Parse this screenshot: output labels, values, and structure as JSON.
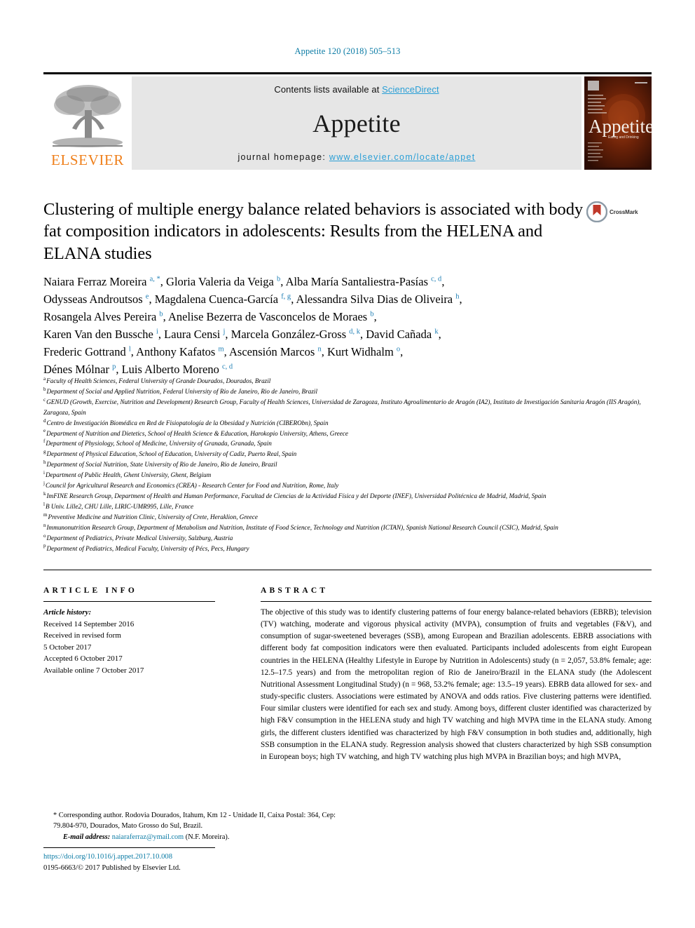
{
  "running_head": "Appetite 120 (2018) 505–513",
  "banner": {
    "publisher_name": "ELSEVIER",
    "contents_prefix": "Contents lists available at ",
    "contents_link": "ScienceDirect",
    "journal_name": "Appetite",
    "homepage_prefix": "journal homepage: ",
    "homepage_url": "www.elsevier.com/locate/appet",
    "cover_title": "Appetite",
    "cover_subtitle": "Eating and Drinking"
  },
  "article": {
    "title": "Clustering of multiple energy balance related behaviors is associated with body fat composition indicators in adolescents: Results from the HELENA and ELANA studies",
    "crossmark_label": "CrossMark"
  },
  "authors": {
    "lines": [
      [
        {
          "name": "Naiara Ferraz Moreira",
          "sup": "a, *"
        },
        {
          "name": "Gloria Valeria da Veiga",
          "sup": "b"
        },
        {
          "name": "Alba María Santaliestra-Pasías",
          "sup": "c, d"
        }
      ],
      [
        {
          "name": "Odysseas Androutsos",
          "sup": "e"
        },
        {
          "name": "Magdalena Cuenca-García",
          "sup": "f, g"
        },
        {
          "name": "Alessandra Silva Dias de Oliveira",
          "sup": "h"
        }
      ],
      [
        {
          "name": "Rosangela Alves Pereira",
          "sup": "b"
        },
        {
          "name": "Anelise Bezerra de Vasconcelos de Moraes",
          "sup": "b"
        }
      ],
      [
        {
          "name": "Karen Van den Bussche",
          "sup": "i"
        },
        {
          "name": "Laura Censi",
          "sup": "j"
        },
        {
          "name": "Marcela González-Gross",
          "sup": "d, k"
        },
        {
          "name": "David Cañada",
          "sup": "k"
        }
      ],
      [
        {
          "name": "Frederic Gottrand",
          "sup": "l"
        },
        {
          "name": "Anthony Kafatos",
          "sup": "m"
        },
        {
          "name": "Ascensión Marcos",
          "sup": "n"
        },
        {
          "name": "Kurt Widhalm",
          "sup": "o"
        }
      ],
      [
        {
          "name": "Dénes Mólnar",
          "sup": "p"
        },
        {
          "name": "Luis Alberto Moreno",
          "sup": "c, d"
        }
      ]
    ]
  },
  "affiliations": [
    {
      "mark": "a",
      "text": "Faculty of Health Sciences, Federal University of Grande Dourados, Dourados, Brazil"
    },
    {
      "mark": "b",
      "text": "Department of Social and Applied Nutrition, Federal University of Rio de Janeiro, Rio de Janeiro, Brazil"
    },
    {
      "mark": "c",
      "text": "GENUD (Growth, Exercise, Nutrition and Development) Research Group, Faculty of Health Sciences, Universidad de Zaragoza, Instituto Agroalimentario de Aragón (IA2), Instituto de Investigación Sanitaria Aragón (IIS Aragón), Zaragoza, Spain"
    },
    {
      "mark": "d",
      "text": "Centro de Investigación Biomédica en Red de Fisiopatología de la Obesidad y Nutrición (CIBERObn), Spain"
    },
    {
      "mark": "e",
      "text": "Department of Nutrition and Dietetics, School of Health Science & Education, Harokopio University, Athens, Greece"
    },
    {
      "mark": "f",
      "text": "Department of Physiology, School of Medicine, University of Granada, Granada, Spain"
    },
    {
      "mark": "g",
      "text": "Department of Physical Education, School of Education, University of Cadiz, Puerto Real, Spain"
    },
    {
      "mark": "h",
      "text": "Department of Social Nutrition, State University of Rio de Janeiro, Rio de Janeiro, Brazil"
    },
    {
      "mark": "i",
      "text": "Department of Public Health, Ghent University, Ghent, Belgium"
    },
    {
      "mark": "j",
      "text": "Council for Agricultural Research and Economics (CREA) - Research Center for Food and Nutrition, Rome, Italy"
    },
    {
      "mark": "k",
      "text": "ImFINE Research Group, Department of Health and Human Performance, Facultad de Ciencias de la Actividad Física y del Deporte (INEF), Universidad Politécnica de Madrid, Madrid, Spain"
    },
    {
      "mark": "l",
      "text": "B Univ. Lille2, CHU Lille, LIRIC-UMR995, Lille, France"
    },
    {
      "mark": "m",
      "text": "Preventive Medicine and Nutrition Clinic, University of Crete, Heraklion, Greece"
    },
    {
      "mark": "n",
      "text": "Immunonutrition Research Group, Department of Metabolism and Nutrition, Institute of Food Science, Technology and Nutrition (ICTAN), Spanish National Research Council (CSIC), Madrid, Spain"
    },
    {
      "mark": "o",
      "text": "Department of Pediatrics, Private Medical University, Salzburg, Austria"
    },
    {
      "mark": "p",
      "text": "Department of Pediatrics, Medical Faculty, University of Pécs, Pecs, Hungary"
    }
  ],
  "article_info": {
    "heading": "ARTICLE INFO",
    "history_label": "Article history:",
    "history_lines": [
      "Received 14 September 2016",
      "Received in revised form",
      "5 October 2017",
      "Accepted 6 October 2017",
      "Available online 7 October 2017"
    ]
  },
  "abstract": {
    "heading": "ABSTRACT",
    "body": "The objective of this study was to identify clustering patterns of four energy balance-related behaviors (EBRB); television (TV) watching, moderate and vigorous physical activity (MVPA), consumption of fruits and vegetables (F&V), and consumption of sugar-sweetened beverages (SSB), among European and Brazilian adolescents. EBRB associations with different body fat composition indicators were then evaluated. Participants included adolescents from eight European countries in the HELENA (Healthy Lifestyle in Europe by Nutrition in Adolescents) study (n = 2,057, 53.8% female; age: 12.5–17.5 years) and from the metropolitan region of Rio de Janeiro/Brazil in the ELANA study (the Adolescent Nutritional Assessment Longitudinal Study) (n = 968, 53.2% female; age: 13.5–19 years). EBRB data allowed for sex- and study-specific clusters. Associations were estimated by ANOVA and odds ratios. Five clustering patterns were identified. Four similar clusters were identified for each sex and study. Among boys, different cluster identified was characterized by high F&V consumption in the HELENA study and high TV watching and high MVPA time in the ELANA study. Among girls, the different clusters identified was characterized by high F&V consumption in both studies and, additionally, high SSB consumption in the ELANA study. Regression analysis showed that clusters characterized by high SSB consumption in European boys; high TV watching, and high TV watching plus high MVPA in Brazilian boys; and high MVPA,"
  },
  "footnote": {
    "star": "*",
    "corresponding": "Corresponding author. Rodovia Dourados, Itahum, Km 12 - Unidade II, Caixa Postal: 364, Cep: 79.804-970, Dourados, Mato Grosso do Sul, Brazil.",
    "email_label": "E-mail address:",
    "email": "naiaraferraz@ymail.com",
    "email_attribution": "(N.F. Moreira)."
  },
  "footer": {
    "doi": "https://doi.org/10.1016/j.appet.2017.10.008",
    "copyright": "0195-6663/© 2017 Published by Elsevier Ltd."
  },
  "colors": {
    "link": "#0b7ba5",
    "sciencedirect": "#2a9fd6",
    "elsevier_orange": "#ef7f1a",
    "superscript": "#1f7fb5"
  }
}
